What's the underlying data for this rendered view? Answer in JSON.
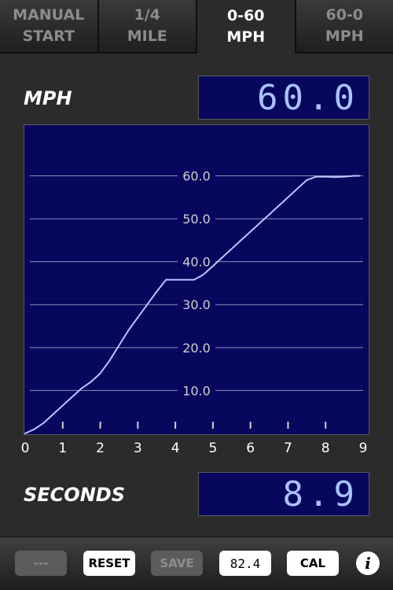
{
  "tabs": [
    {
      "line1": "MANUAL",
      "line2": "START",
      "active": false
    },
    {
      "line1": "1/4",
      "line2": "MILE",
      "active": false
    },
    {
      "line1": "0-60",
      "line2": "MPH",
      "active": true
    },
    {
      "line1": "60-0",
      "line2": "MPH",
      "active": false
    }
  ],
  "speed": {
    "label": "MPH",
    "value": "60.0"
  },
  "time": {
    "label": "SECONDS",
    "value": "8.9"
  },
  "chart_data": {
    "type": "line",
    "x_ticks": [
      "0",
      "1",
      "2",
      "3",
      "4",
      "5",
      "6",
      "7",
      "8",
      "9"
    ],
    "y_ticks": [
      "10.0",
      "20.0",
      "30.0",
      "40.0",
      "50.0",
      "60.0"
    ],
    "xlim": [
      0,
      9
    ],
    "ylim": [
      0,
      66.5
    ],
    "grid": true,
    "series": [
      {
        "x": [
          0,
          0.25,
          0.5,
          0.75,
          1.0,
          1.25,
          1.5,
          1.75,
          2.0,
          2.25,
          2.5,
          2.75,
          3.0,
          3.25,
          3.5,
          3.75,
          4.0,
          4.25,
          4.5,
          4.75,
          5.0,
          5.5,
          6.0,
          6.5,
          7.0,
          7.5,
          7.75,
          8.0,
          8.25,
          8.5,
          8.75,
          8.9
        ],
        "y": [
          0,
          1,
          2.5,
          4.5,
          6.5,
          8.5,
          10.5,
          12,
          14,
          17,
          20.5,
          24,
          27,
          30,
          33,
          35.8,
          35.8,
          35.8,
          35.8,
          37,
          39,
          43,
          47,
          51,
          55,
          59,
          59.8,
          59.8,
          59.7,
          59.8,
          60,
          60
        ]
      }
    ],
    "line_color": "#b7c6ff",
    "background_color": "#07075e"
  },
  "toolbar": {
    "dash_label": "---",
    "reset_label": "RESET",
    "save_label": "SAVE",
    "value_label": "82.4",
    "cal_label": "CAL",
    "info_label": "i"
  }
}
